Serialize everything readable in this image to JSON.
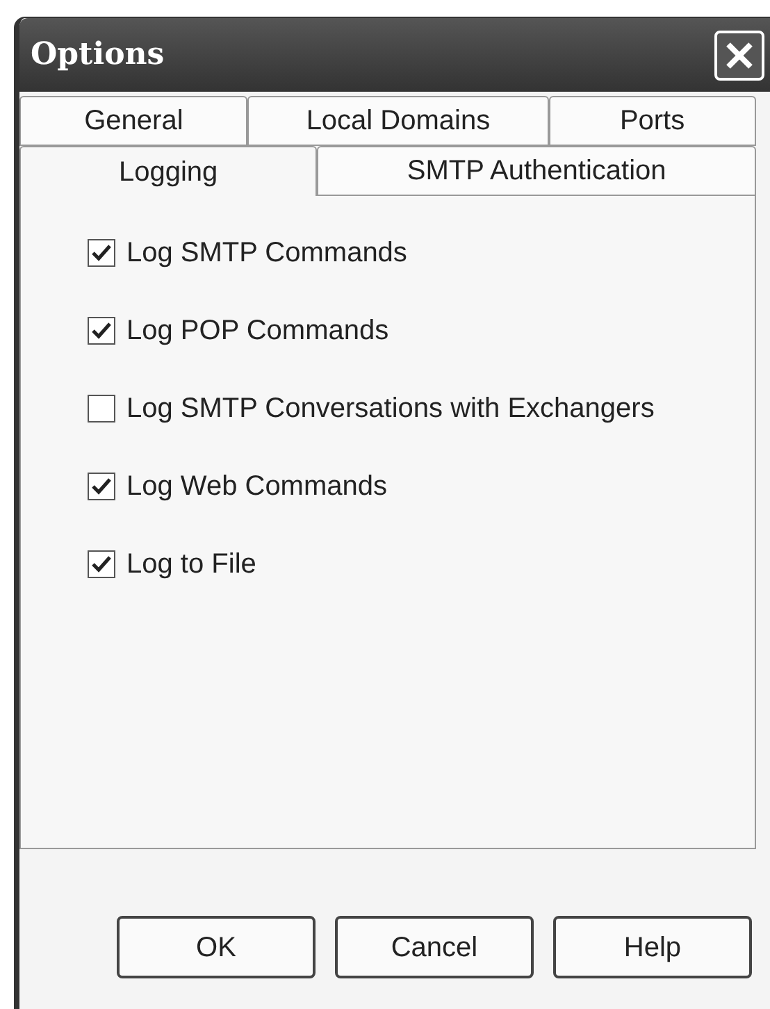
{
  "window": {
    "title": "Options"
  },
  "tab_rows": [
    [
      {
        "label": "General",
        "selected": false
      },
      {
        "label": "Local Domains",
        "selected": false
      },
      {
        "label": "Ports",
        "selected": false
      }
    ],
    [
      {
        "label": "Logging",
        "selected": true
      },
      {
        "label": "SMTP Authentication",
        "selected": false
      }
    ]
  ],
  "options": [
    {
      "label": "Log SMTP Commands",
      "checked": true
    },
    {
      "label": "Log POP Commands",
      "checked": true
    },
    {
      "label": "Log SMTP Conversations with Exchangers",
      "checked": false
    },
    {
      "label": "Log Web Commands",
      "checked": true
    },
    {
      "label": "Log to File",
      "checked": true
    }
  ],
  "buttons": [
    "OK",
    "Cancel",
    "Help"
  ]
}
